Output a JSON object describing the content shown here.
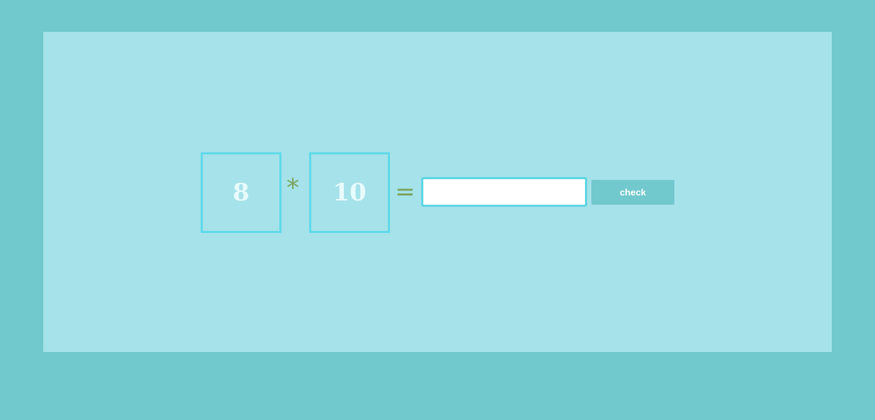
{
  "problem": {
    "operand_a": "8",
    "operator": "*",
    "operand_b": "10",
    "equals": "="
  },
  "answer": {
    "value": "",
    "placeholder": ""
  },
  "check_button": {
    "label": "check"
  },
  "colors": {
    "background": "#71c8cd",
    "panel": "#a6e2e9",
    "box_border": "#5fdaea",
    "operator": "#7aa45d",
    "button": "#71c8cd"
  }
}
